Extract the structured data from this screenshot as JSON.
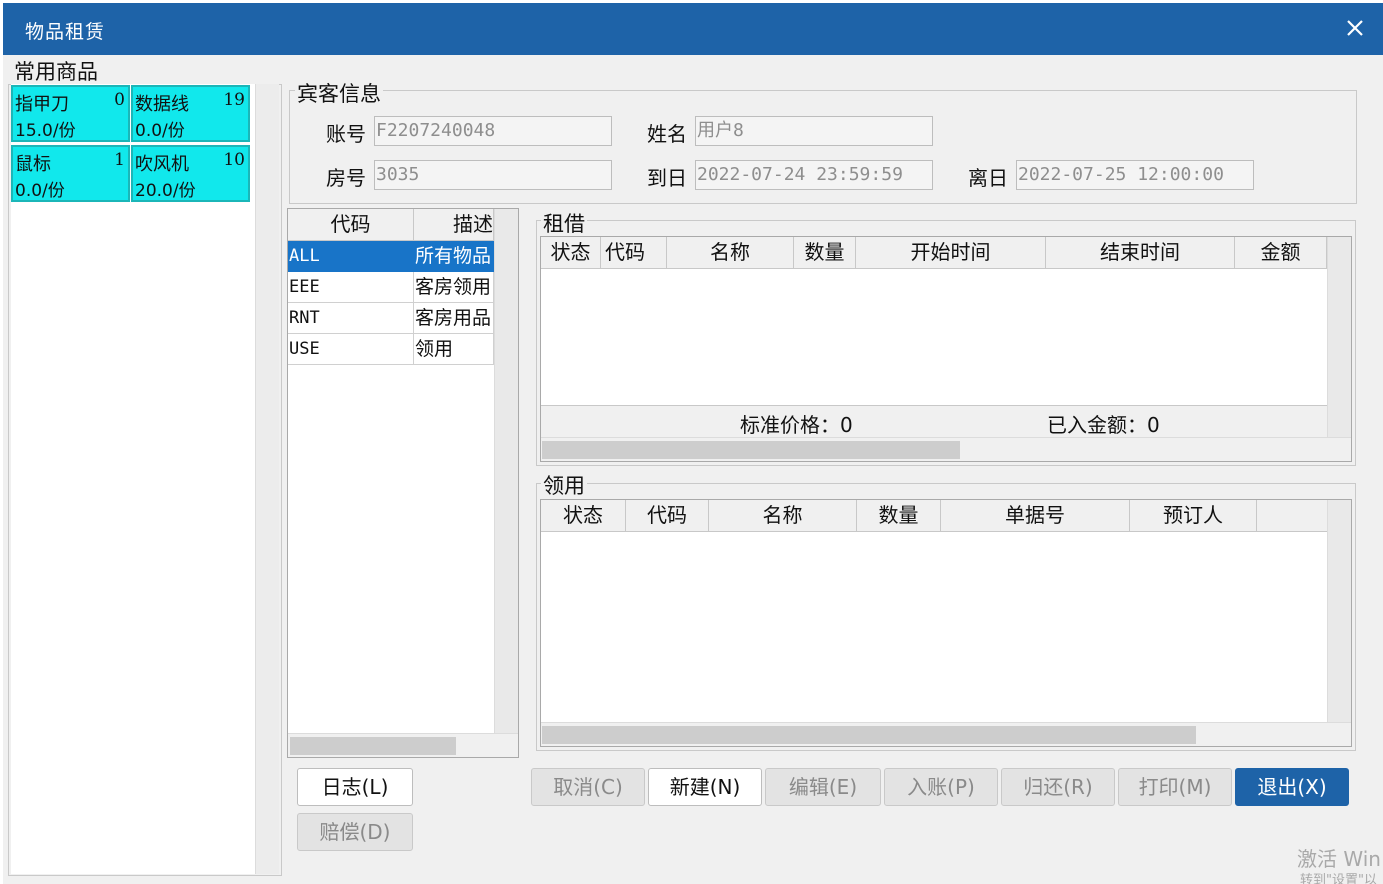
{
  "window": {
    "title": "物品租赁",
    "close_icon": "close-icon"
  },
  "favorites": {
    "legend": "常用商品",
    "items": [
      {
        "name": "指甲刀",
        "count": "0",
        "price": "15.0/份"
      },
      {
        "name": "数据线",
        "count": "19",
        "price": "0.0/份"
      },
      {
        "name": "鼠标",
        "count": "1",
        "price": "0.0/份"
      },
      {
        "name": "吹风机",
        "count": "10",
        "price": "20.0/份"
      }
    ]
  },
  "guest": {
    "legend": "宾客信息",
    "account_label": "账号",
    "account_value": "F2207240048",
    "name_label": "姓名",
    "name_value": "用户8",
    "room_label": "房号",
    "room_value": "3035",
    "arrive_label": "到日",
    "arrive_value": "2022-07-24 23:59:59",
    "depart_label": "离日",
    "depart_value": "2022-07-25 12:00:00"
  },
  "category": {
    "headers": [
      "代码",
      "描述"
    ],
    "rows": [
      {
        "code": "ALL",
        "desc": "所有物品"
      },
      {
        "code": "EEE",
        "desc": "客房领用"
      },
      {
        "code": "RNT",
        "desc": "客房用品"
      },
      {
        "code": "USE",
        "desc": "领用"
      }
    ]
  },
  "rent": {
    "legend": "租借",
    "headers": [
      "状态",
      "代码",
      "名称",
      "数量",
      "开始时间",
      "结束时间",
      "金额"
    ],
    "std_price_label": "标准价格：0",
    "paid_label": "已入金额：0"
  },
  "use": {
    "legend": "领用",
    "headers": [
      "状态",
      "代码",
      "名称",
      "数量",
      "单据号",
      "预订人"
    ]
  },
  "buttons": {
    "log": "日志(L)",
    "compensate": "赔偿(D)",
    "cancel": "取消(C)",
    "new": "新建(N)",
    "edit": "编辑(E)",
    "post": "入账(P)",
    "return": "归还(R)",
    "print": "打印(M)",
    "exit": "退出(X)"
  },
  "watermark": {
    "line1": "激活 Win",
    "line2": "转到\"设置\"以"
  }
}
